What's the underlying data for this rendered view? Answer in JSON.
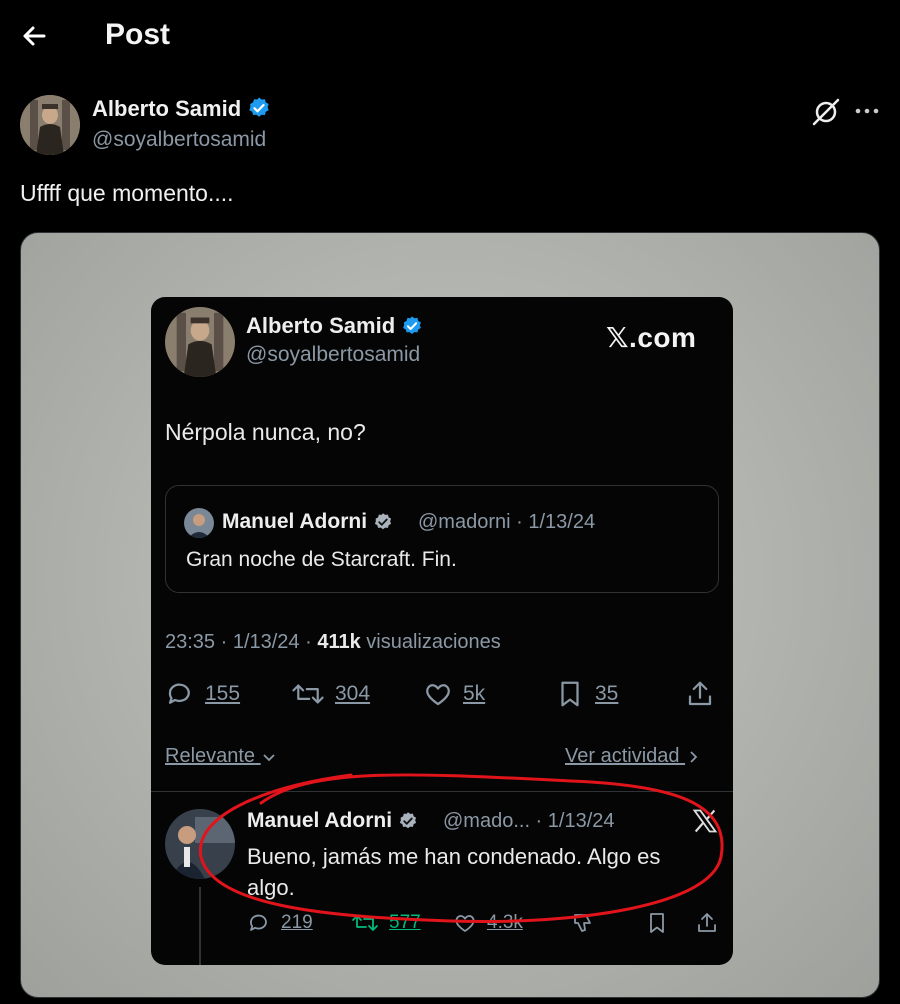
{
  "header": {
    "back_icon": "arrow-left-icon",
    "title": "Post"
  },
  "post": {
    "author_name": "Alberto Samid",
    "author_handle": "@soyalbertosamid",
    "text": "Uffff que momento....",
    "grok_icon": "grok-icon",
    "more_icon": "more-horizontal-icon"
  },
  "screenshot": {
    "author_name": "Alberto Samid",
    "author_handle": "@soyalbertosamid",
    "brand": "𝕏.com",
    "text": "Nérpola nunca, no?",
    "quote": {
      "name": "Manuel Adorni",
      "handle_date": "@madorni · 1/13/24",
      "text": "Gran noche de Starcraft. Fin."
    },
    "meta": {
      "time_date": "23:35 · 1/13/24 · ",
      "views_count": "411k",
      "views_label": " visualizaciones"
    },
    "actions": {
      "replies": "155",
      "reposts": "304",
      "likes": "5k",
      "bookmarks": "35"
    },
    "relevant_label": "Relevante",
    "activity_label": "Ver actividad",
    "reply": {
      "name": "Manuel Adorni",
      "handle_date": "@mado... · 1/13/24",
      "text": "Bueno, jamás me han condenado. Algo es algo.",
      "replies": "219",
      "reposts": "577",
      "likes": "4.3k"
    }
  },
  "colors": {
    "background": "#000000",
    "verified": "#1d9bf0",
    "repost_green": "#00ba7c",
    "annotation_red": "#e0141a"
  }
}
